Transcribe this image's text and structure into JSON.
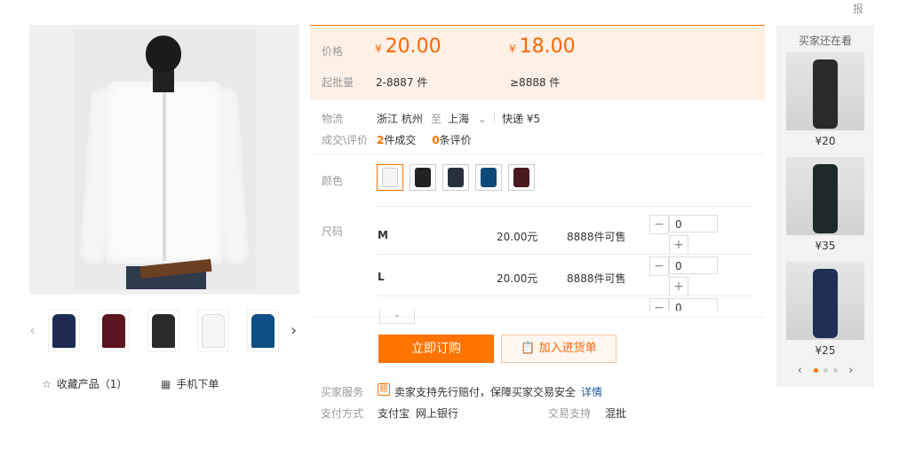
{
  "report_label": "报",
  "gallery": {
    "thumb_colors": [
      "#1f2a52",
      "#5a1520",
      "#2a2a2a",
      "#f6f6f6",
      "#0e4f86"
    ],
    "prev_icon": "chevron-left-icon",
    "next_icon": "chevron-right-icon",
    "favorite_label": "收藏产品（1）",
    "mobile_label": "手机下单"
  },
  "price": {
    "price_label": "价格",
    "currency": "¥",
    "price_1": "20.00",
    "price_2": "18.00",
    "moq_label": "起批量",
    "range_1": "2-8887 件",
    "range_2": "≥8888 件"
  },
  "logistics": {
    "label": "物流",
    "from": "浙江 杭州",
    "to_word": "至",
    "to": "上海",
    "express": "快递 ¥5"
  },
  "deals": {
    "label": "成交\\评价",
    "count": "2",
    "count_suffix": "件成交",
    "reviews": "0",
    "reviews_suffix": "条评价"
  },
  "colors": {
    "label": "颜色",
    "options": [
      "#f5f5f5",
      "#222222",
      "#2a2f40",
      "#0d4a7a",
      "#4a1a22"
    ]
  },
  "sizes": {
    "label": "尺码",
    "rows": [
      {
        "name": "M",
        "price": "20.00元",
        "stock": "8888件可售",
        "qty": "0"
      },
      {
        "name": "L",
        "price": "20.00元",
        "stock": "8888件可售",
        "qty": "0"
      },
      {
        "name": "",
        "price": "",
        "stock": "",
        "qty": "0"
      }
    ]
  },
  "actions": {
    "order_label": "立即订购",
    "cart_label": "加入进货单"
  },
  "service": {
    "buyer_label": "买家服务",
    "buyer_text": "卖家支持先行赔付，保障买家交易安全",
    "detail_link": "详情",
    "pay_label": "支付方式",
    "pay_1": "支付宝",
    "pay_2": "网上银行",
    "trade_label": "交易支持",
    "trade_value": "混批"
  },
  "rail": {
    "title": "买家还在看",
    "items": [
      {
        "price": "¥20",
        "color": "#2a2a2a"
      },
      {
        "price": "¥35",
        "color": "#1e2a2a"
      },
      {
        "price": "¥25",
        "color": "#1f2f55"
      }
    ]
  }
}
